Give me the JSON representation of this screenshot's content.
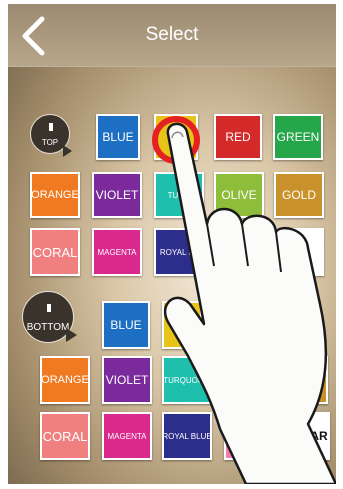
{
  "header": {
    "title": "Select",
    "back_icon": "chevron-left-icon"
  },
  "top_group": {
    "position_label": "TOP",
    "rows": [
      [
        {
          "label": "BLUE",
          "color": "#1c6fc2"
        },
        {
          "label": "YE",
          "color": "#e8c31a"
        },
        {
          "label": "RED",
          "color": "#d42a2a"
        },
        {
          "label": "GREEN",
          "color": "#26a64a"
        }
      ],
      [
        {
          "label": "ORANGE",
          "color": "#f07a22"
        },
        {
          "label": "VIOLET",
          "color": "#7a2a9a"
        },
        {
          "label": "TURQ",
          "color": "#1fbfae"
        },
        {
          "label": "OLIVE",
          "color": "#8dbd3a"
        },
        {
          "label": "GOLD",
          "color": "#c8912a"
        }
      ],
      [
        {
          "label": "CORAL",
          "color": "#f08080"
        },
        {
          "label": "MAGENTA",
          "color": "#d9298c"
        },
        {
          "label": "ROYAL BL",
          "color": "#2d2e8c"
        }
      ]
    ]
  },
  "bottom_group": {
    "position_label": "BOTTOM",
    "rows": [
      [
        {
          "label": "BLUE",
          "color": "#1c6fc2"
        },
        {
          "label": "YE",
          "color": "#e8c31a"
        }
      ],
      [
        {
          "label": "ORANGE",
          "color": "#f07a22"
        },
        {
          "label": "VIOLET",
          "color": "#7a2a9a"
        },
        {
          "label": "TURQUOISE",
          "color": "#1fbfae"
        },
        {
          "label": "",
          "color": "#8dbd3a"
        },
        {
          "label": "",
          "color": "#c8912a"
        }
      ],
      [
        {
          "label": "CORAL",
          "color": "#f08080"
        },
        {
          "label": "MAGENTA",
          "color": "#d9298c"
        },
        {
          "label": "ROYAL BLUE",
          "color": "#2d2e8c"
        },
        {
          "label": "PINK",
          "color": "#f27db0"
        },
        {
          "label": "CLEAR",
          "color": "#ffffff"
        }
      ]
    ]
  },
  "selection_ring_color": "#e52222"
}
